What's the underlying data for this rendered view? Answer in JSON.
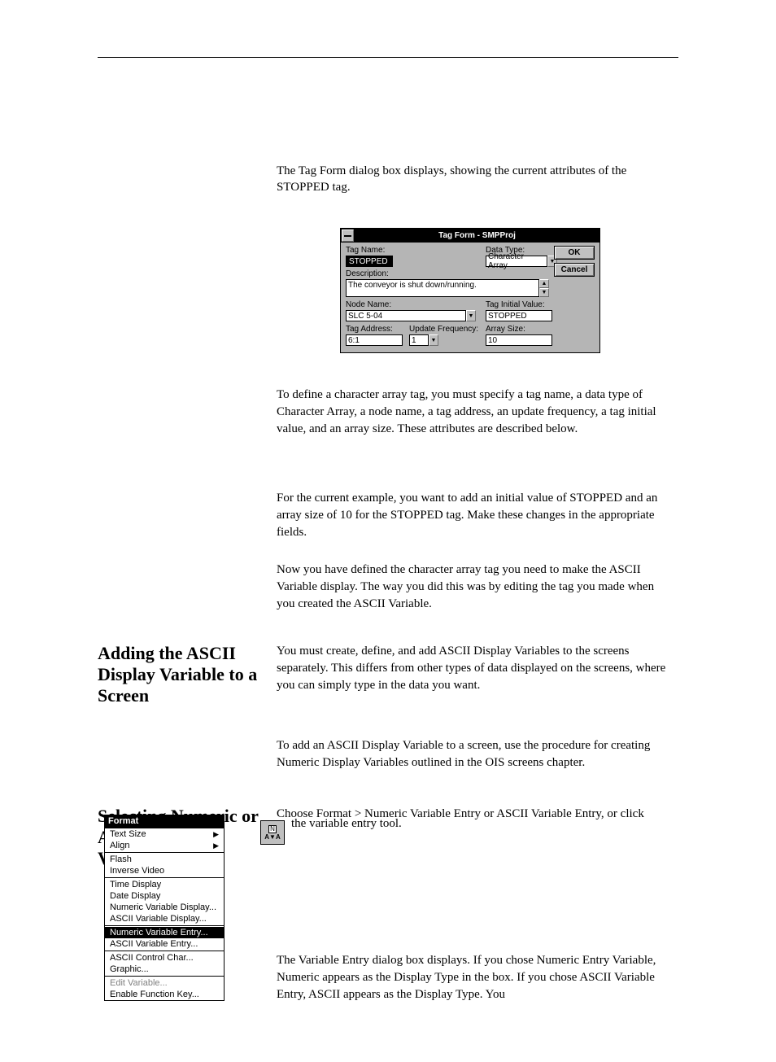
{
  "intro": {
    "para1": "The Tag Form dialog box displays, showing the current attributes of the STOPPED tag.",
    "para2": "To define a character array tag, you must specify a tag name, a data type of Character Array, a node name, a tag address, an update frequency, a tag initial value, and an array size. These attributes are described below.",
    "para3": "For the current example, you want to add an initial value of STOPPED and an array size of 10 for the STOPPED tag. Make these changes in the appropriate fields.",
    "para4": "Now you have defined the character array tag you need to make the ASCII Variable display. The way you did this was by editing the tag you made when you created the ASCII Variable."
  },
  "dialog": {
    "title": "Tag Form - SMPProj",
    "tagname_label": "Tag Name:",
    "tagname_value": "STOPPED",
    "datatype_label": "Data Type:",
    "datatype_value": "Character Array",
    "ok": "OK",
    "cancel": "Cancel",
    "desc_label": "Description:",
    "desc_value": "The conveyor is shut down/running.",
    "node_label": "Node Name:",
    "node_value": "SLC 5-04",
    "initval_label": "Tag Initial Value:",
    "initval_value": "STOPPED",
    "addr_label": "Tag Address:",
    "addr_value": "6:1",
    "freq_label": "Update Frequency:",
    "freq_value": "1",
    "arraysize_label": "Array Size:",
    "arraysize_value": "10"
  },
  "headings": {
    "adding": "Adding the ASCII Display Variable to a Screen",
    "selecting": "Selecting Numeric or ASCII Entry Variables"
  },
  "body": {
    "adding1": "You must create, define, and add ASCII Display Variables to the screens separately. This differs from other types of data displayed on the screens, where you can simply type in the data you want.",
    "adding2": "To add an ASCII Display Variable to a screen, use the procedure for creating Numeric Display Variables outlined in the OIS screens chapter.",
    "selecting1": "Choose Format > Numeric Variable Entry or ASCII Variable Entry, or click",
    "selecting2": "the variable entry tool.",
    "selecting3": "The Variable Entry dialog box displays. If you chose Numeric Entry Variable, Numeric appears as the Display Type in the box. If you chose ASCII Variable Entry, ASCII appears as the Display Type. You"
  },
  "menu": {
    "title": "Format",
    "items": [
      {
        "label": "Text Size",
        "sub": true,
        "enabled": true
      },
      {
        "label": "Align",
        "sub": true,
        "enabled": true
      },
      {
        "sep": true
      },
      {
        "label": "Flash",
        "enabled": true
      },
      {
        "label": "Inverse Video",
        "enabled": true
      },
      {
        "sep": true
      },
      {
        "label": "Time Display",
        "enabled": true
      },
      {
        "label": "Date Display",
        "enabled": true
      },
      {
        "label": "Numeric Variable Display...",
        "enabled": true
      },
      {
        "label": "ASCII Variable Display...",
        "enabled": true
      },
      {
        "sep": true
      },
      {
        "label": "Numeric Variable Entry...",
        "enabled": true,
        "hl": true
      },
      {
        "label": "ASCII Variable Entry...",
        "enabled": true
      },
      {
        "sep": true
      },
      {
        "label": "ASCII Control Char...",
        "enabled": true
      },
      {
        "label": "Graphic...",
        "enabled": true
      },
      {
        "sep": true
      },
      {
        "label": "Edit Variable...",
        "enabled": false
      },
      {
        "label": "Enable Function Key...",
        "enabled": true
      }
    ]
  },
  "icon": {
    "top": "N",
    "bot": "A▼A"
  }
}
